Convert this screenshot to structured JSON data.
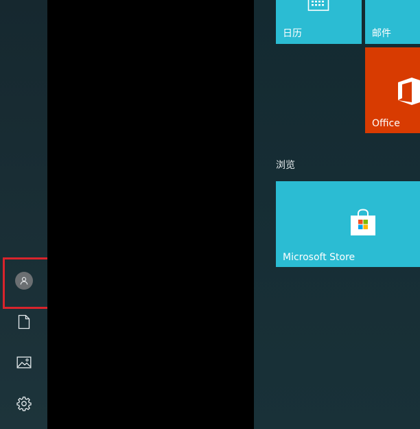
{
  "tiles": {
    "calendar": {
      "label": "日历",
      "icon": "calendar-icon",
      "color": "#2bbcd3"
    },
    "mail": {
      "label": "邮件",
      "icon": "mail-icon",
      "color": "#2bbcd3"
    },
    "office": {
      "label": "Office",
      "icon": "office-icon",
      "color": "#d83b01"
    },
    "store": {
      "label": "Microsoft Store",
      "icon": "store-bag-icon",
      "color": "#2bbcd3"
    }
  },
  "groups": {
    "browse": {
      "title": "浏览"
    }
  },
  "rail": {
    "items": [
      {
        "name": "user-account",
        "icon": "person-icon"
      },
      {
        "name": "documents",
        "icon": "document-icon"
      },
      {
        "name": "pictures",
        "icon": "picture-icon"
      },
      {
        "name": "settings",
        "icon": "gear-icon"
      }
    ]
  },
  "annotation": {
    "highlight_color": "#d9242c"
  }
}
